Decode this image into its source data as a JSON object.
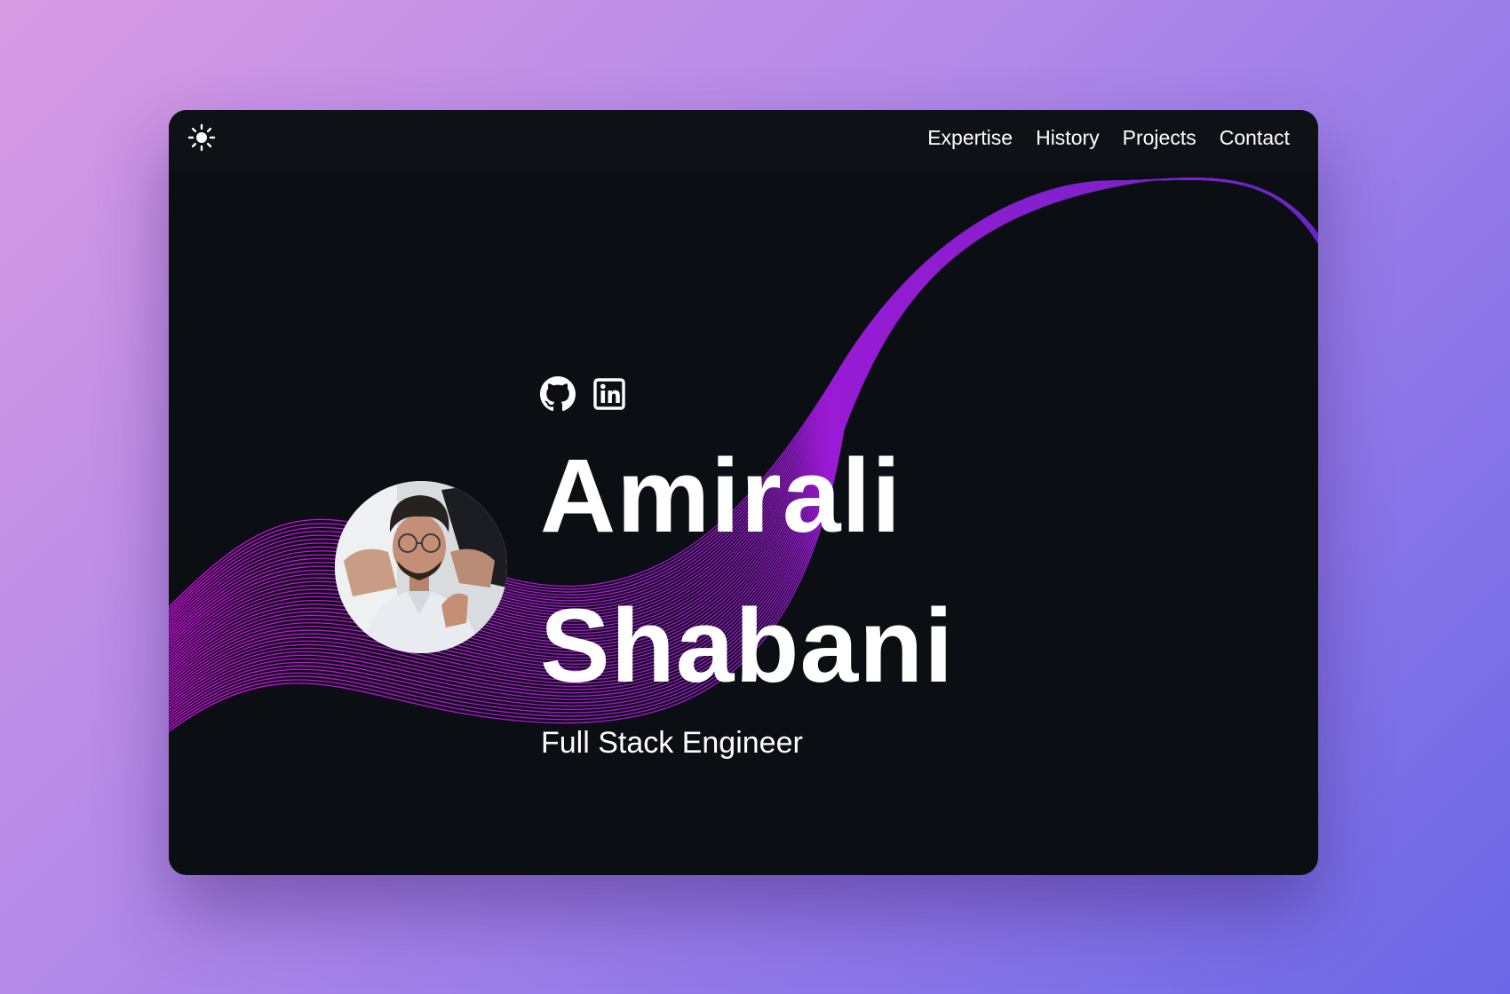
{
  "nav": {
    "theme_icon": "sun-icon",
    "items": [
      {
        "label": "Expertise"
      },
      {
        "label": "History"
      },
      {
        "label": "Projects"
      },
      {
        "label": "Contact"
      }
    ]
  },
  "hero": {
    "socials": [
      {
        "icon": "github-icon"
      },
      {
        "icon": "linkedin-icon"
      }
    ],
    "first_name": "Amirali",
    "last_name": "Shabani",
    "role": "Full Stack Engineer",
    "avatar": "profile-photo"
  },
  "colors": {
    "page_bg_start": "#d79ae3",
    "page_bg_end": "#6b67e6",
    "window_bg": "#0b0e13",
    "topbar_bg": "#0e1116",
    "wave_start": "#d20ee6",
    "wave_end": "#6a26c4",
    "text": "#ffffff"
  }
}
